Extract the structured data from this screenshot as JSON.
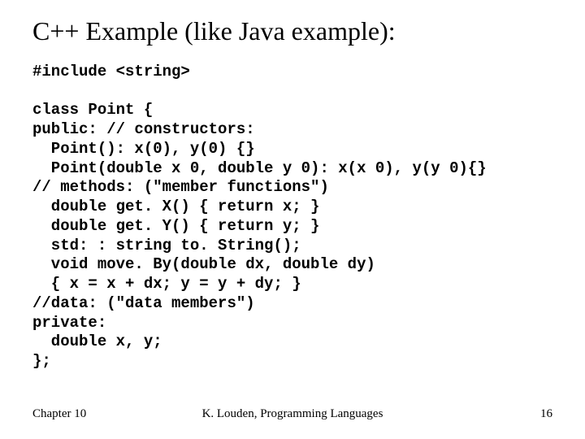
{
  "title": "C++ Example (like Java example):",
  "code": "#include <string>\n\nclass Point {\npublic: // constructors:\n  Point(): x(0), y(0) {}\n  Point(double x 0, double y 0): x(x 0), y(y 0){}\n// methods: (\"member functions\")\n  double get. X() { return x; }\n  double get. Y() { return y; }\n  std: : string to. String();\n  void move. By(double dx, double dy)\n  { x = x + dx; y = y + dy; }\n//data: (\"data members\")\nprivate:\n  double x, y;\n};",
  "footer": {
    "left": "Chapter 10",
    "center": "K. Louden, Programming Languages",
    "right": "16"
  }
}
